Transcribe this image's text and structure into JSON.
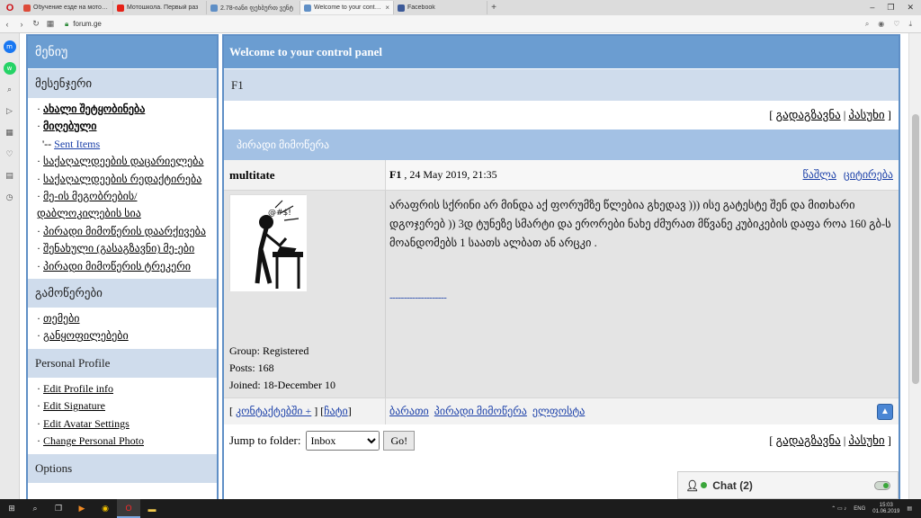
{
  "browser": {
    "tabs": [
      {
        "label": "Обучение езде на мотоцик",
        "color": "#dd4b39",
        "active": false
      },
      {
        "label": "Мотошкола. Первый раз",
        "color": "#e62117",
        "active": false
      },
      {
        "label": "2.78-იანი ფეხბურთ ვენტ",
        "color": "#5f8fc6",
        "active": false
      },
      {
        "label": "Welcome to your control pa",
        "color": "#5f8fc6",
        "active": true
      },
      {
        "label": "Facebook",
        "color": "#3b5998",
        "active": false
      }
    ],
    "url": "forum.ge"
  },
  "sidebar": {
    "title": "მენიუ",
    "sections": [
      {
        "title": "მესენჯერი",
        "items": [
          {
            "label": "ახალი შეტყობინება",
            "bold": true
          },
          {
            "label": "მიღებული",
            "bold": true
          },
          {
            "label": "Sent Items",
            "prefix": "'-- "
          },
          {
            "label": "საქაღალდეების დაცარიელება"
          },
          {
            "label": "საქაღალდეების რედაქტირება"
          },
          {
            "label": "მე-ის მეგობრების/"
          },
          {
            "label": "დაბლოკილების სია",
            "noprefix": true
          },
          {
            "label": "პირადი მიმოწერის დაარქივება"
          },
          {
            "label": "შენახული (გასაგზავნი) მე-ები"
          },
          {
            "label": "პირადი მიმოწერის ტრეკერი"
          }
        ]
      },
      {
        "title": "გამოწერები",
        "items": [
          {
            "label": "თემები"
          },
          {
            "label": "განყოფილებები"
          }
        ]
      },
      {
        "title": "Personal Profile",
        "items": [
          {
            "label": "Edit Profile info"
          },
          {
            "label": "Edit Signature"
          },
          {
            "label": "Edit Avatar Settings"
          },
          {
            "label": "Change Personal Photo"
          }
        ]
      },
      {
        "title": "Options",
        "items": []
      }
    ]
  },
  "main": {
    "title": "Welcome to your control panel",
    "subtitle": "F1",
    "forward_label": "გადაგზავნა",
    "reply_label": "პასუხი",
    "pm_title": "პირადი მიმოწერა",
    "post": {
      "author": "multitate",
      "sender": "F1",
      "date": ", 24 May 2019, 21:35",
      "delete_label": "წაშლა",
      "quote_label": "ციტირება",
      "body": "არაფრის სქრინი არ მინდა აქ ფორუმზე წლებია გხედავ ))) ისე გატესტე შენ და მითხარი დგოჯერებ )) 3დ ტუნეზე სმარტი და ერორები ნახე ძმურათ მწვანე კუბიკების დაფა როა 160 გბ-ს მოანდომებს 1 საათს ალბათ ან არცკი .",
      "signature": "--------------------",
      "group": "Group: Registered",
      "posts": "Posts: 168",
      "joined": "Joined: 18-December 10",
      "contacts_label": "კონტაქტებში +",
      "block_label": "ჩატი",
      "footer_links": [
        "ბარათი",
        "პირადი მიმოწერა",
        "ელფოსტა"
      ]
    },
    "jump_label": "Jump to folder:",
    "folder_selected": "Inbox",
    "go_label": "Go!"
  },
  "chat": {
    "label": "Chat",
    "count": "(2)"
  },
  "taskbar": {
    "lang": "ENG",
    "time": "15:03",
    "date": "01.06.2019"
  },
  "colors": {
    "header_blue": "#6b9dd1",
    "section_bg": "#cfdcec",
    "pm_bar": "#a3c1e4"
  }
}
